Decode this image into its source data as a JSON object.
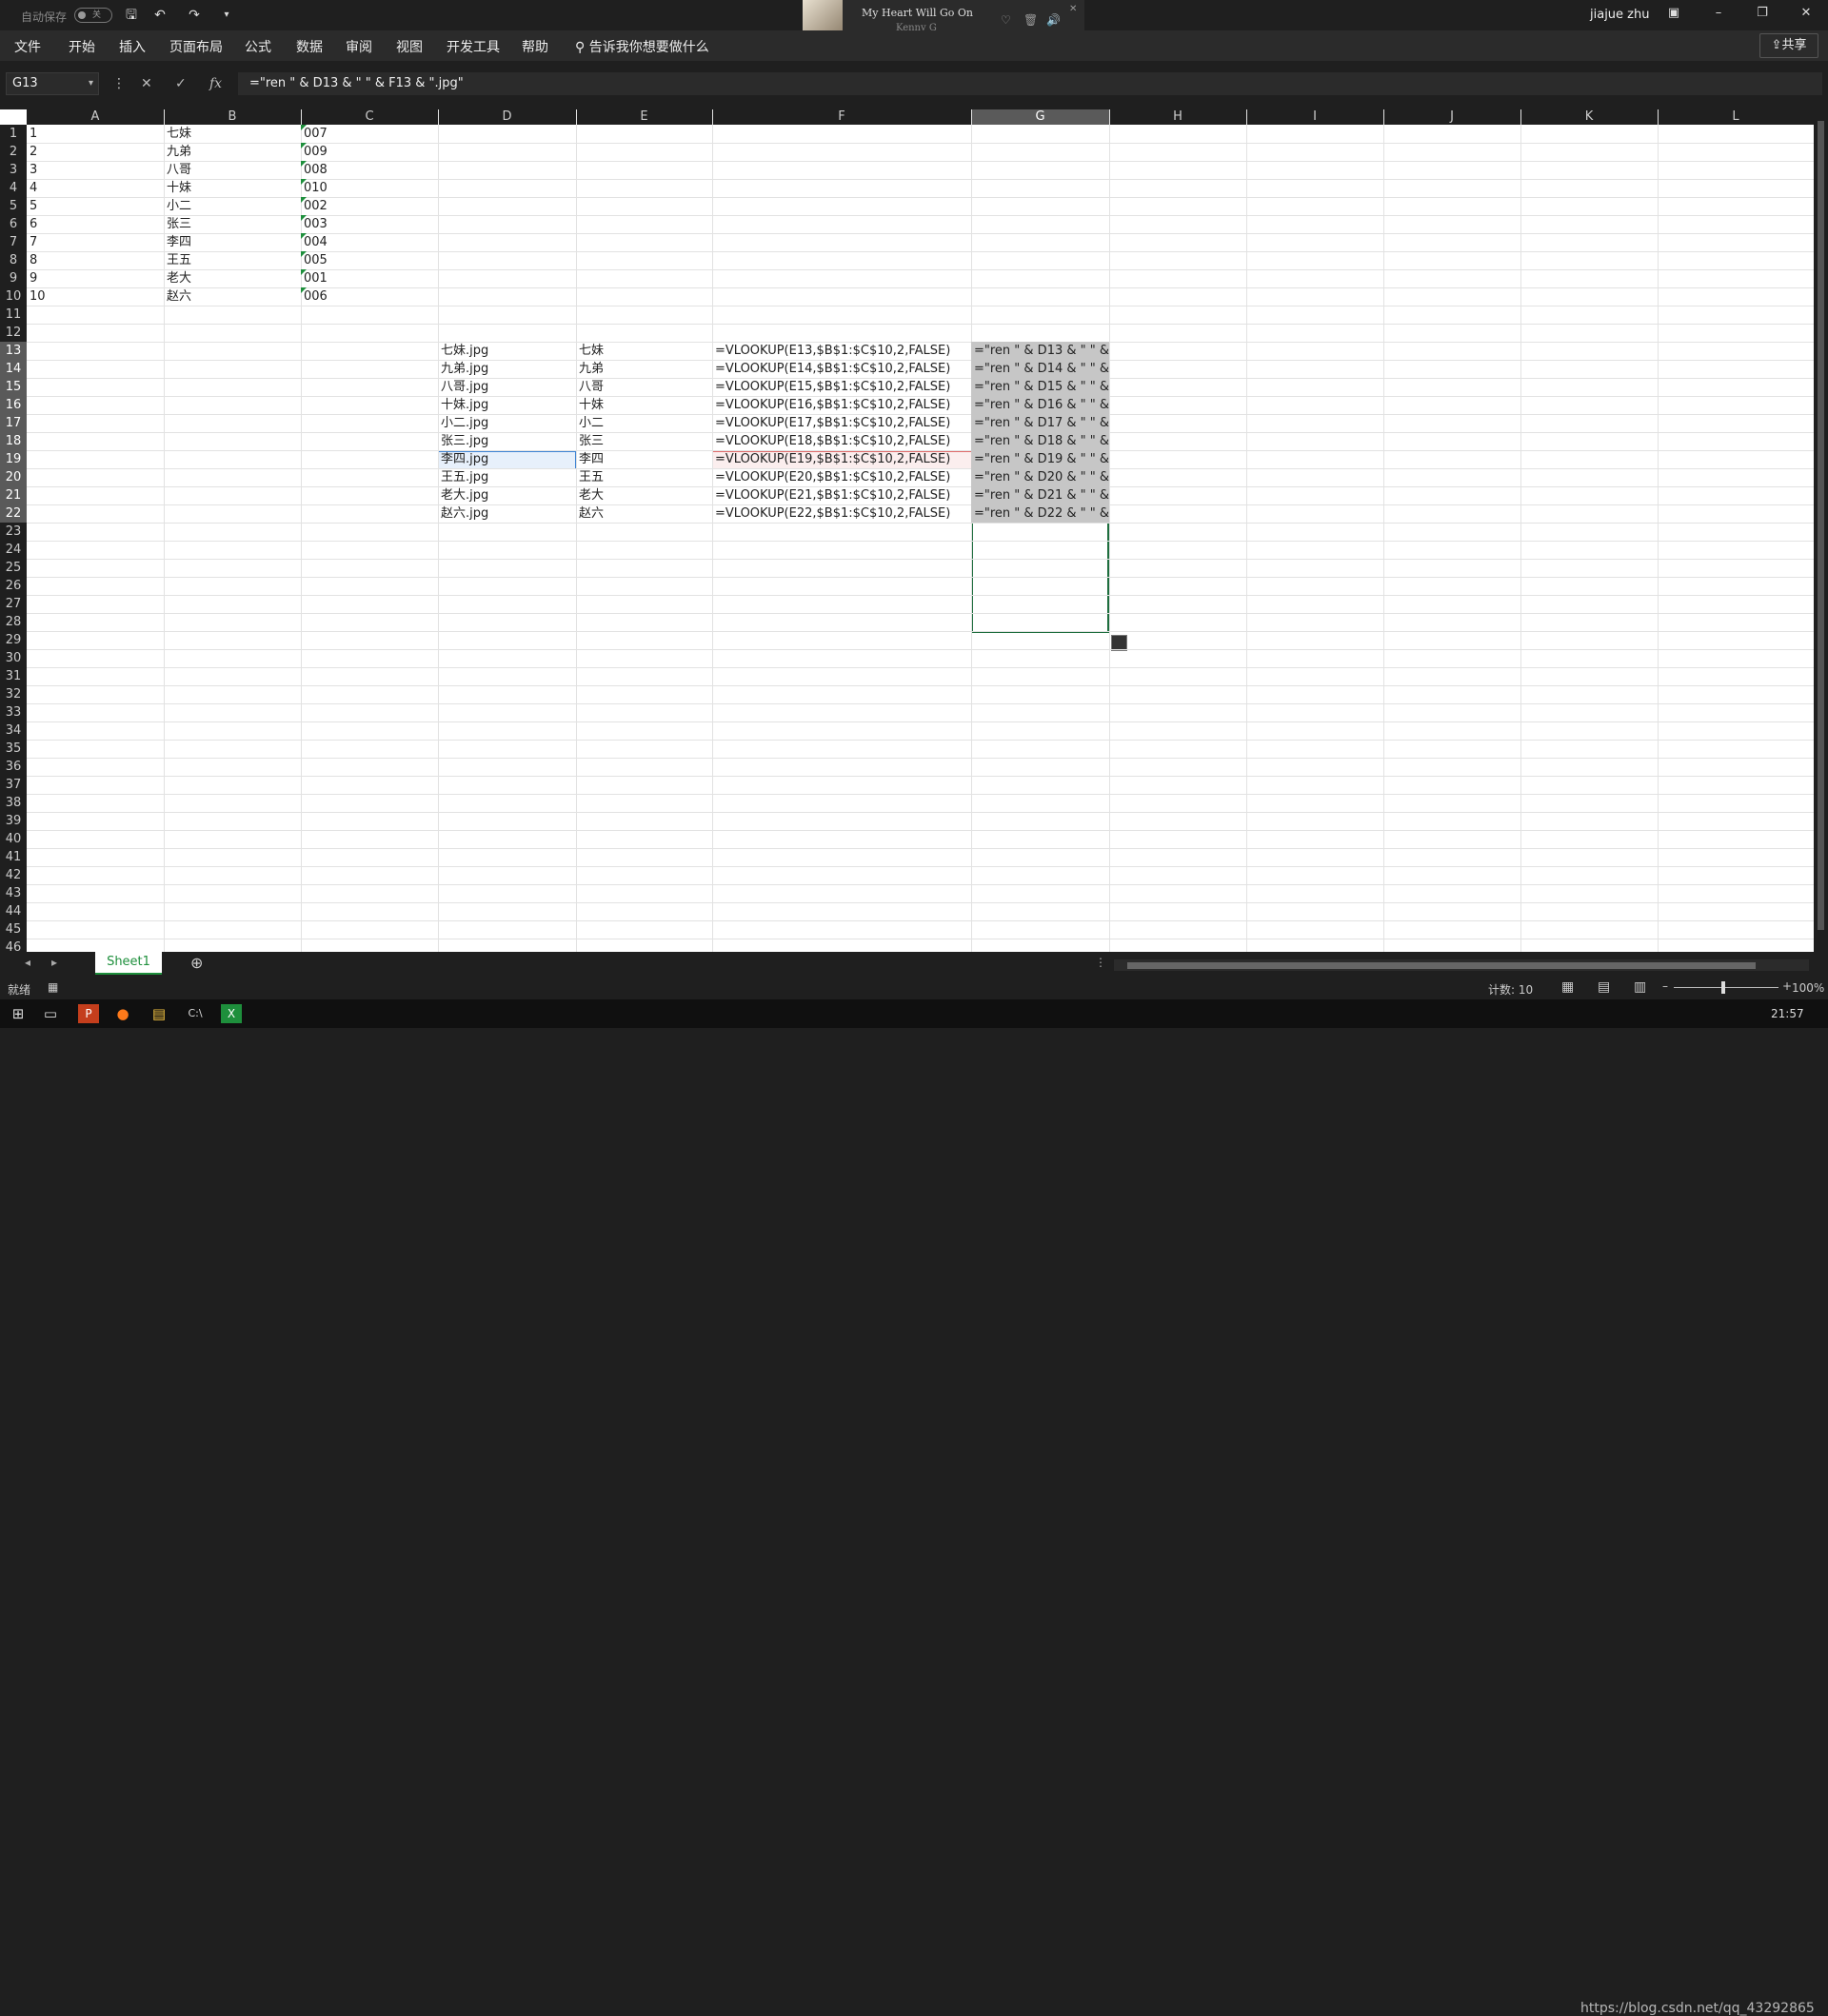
{
  "titlebar": {
    "autosave_label": "自动保存",
    "autosave_state": "关",
    "user": "jiajue zhu"
  },
  "music": {
    "song": "My Heart Will Go On",
    "artist": "Kenny G"
  },
  "ribbon": {
    "tabs": [
      "文件",
      "开始",
      "插入",
      "页面布局",
      "公式",
      "数据",
      "审阅",
      "视图",
      "开发工具",
      "帮助"
    ],
    "search": "告诉我你想要做什么",
    "share": "共享"
  },
  "formula_bar": {
    "namebox": "G13",
    "formula": "=\"ren \" & D13 & \" \" & F13 & \".jpg\""
  },
  "columns": [
    "A",
    "B",
    "C",
    "D",
    "E",
    "F",
    "G",
    "H",
    "I",
    "J",
    "K",
    "L"
  ],
  "rows": [
    "1",
    "2",
    "3",
    "4",
    "5",
    "6",
    "7",
    "8",
    "9",
    "10",
    "11",
    "12",
    "13",
    "14",
    "15",
    "16",
    "17",
    "18",
    "19",
    "20",
    "21",
    "22",
    "23",
    "24",
    "25",
    "26",
    "27",
    "28",
    "29",
    "30",
    "31",
    "32",
    "33",
    "34",
    "35",
    "36",
    "37",
    "38",
    "39",
    "40",
    "41",
    "42",
    "43",
    "44",
    "45",
    "46"
  ],
  "data_a": [
    "1",
    "2",
    "3",
    "4",
    "5",
    "6",
    "7",
    "8",
    "9",
    "10"
  ],
  "data_b": [
    "七妹",
    "九弟",
    "八哥",
    "十妹",
    "小二",
    "张三",
    "李四",
    "王五",
    "老大",
    "赵六"
  ],
  "data_c": [
    "007",
    "009",
    "008",
    "010",
    "002",
    "003",
    "004",
    "005",
    "001",
    "006"
  ],
  "data_d": [
    "七妹.jpg",
    "九弟.jpg",
    "八哥.jpg",
    "十妹.jpg",
    "小二.jpg",
    "张三.jpg",
    "李四.jpg",
    "王五.jpg",
    "老大.jpg",
    "赵六.jpg"
  ],
  "data_e": [
    "七妹",
    "九弟",
    "八哥",
    "十妹",
    "小二",
    "张三",
    "李四",
    "王五",
    "老大",
    "赵六"
  ],
  "data_f": [
    "=VLOOKUP(E13,$B$1:$C$10,2,FALSE)",
    "=VLOOKUP(E14,$B$1:$C$10,2,FALSE)",
    "=VLOOKUP(E15,$B$1:$C$10,2,FALSE)",
    "=VLOOKUP(E16,$B$1:$C$10,2,FALSE)",
    "=VLOOKUP(E17,$B$1:$C$10,2,FALSE)",
    "=VLOOKUP(E18,$B$1:$C$10,2,FALSE)",
    "=VLOOKUP(E19,$B$1:$C$10,2,FALSE)",
    "=VLOOKUP(E20,$B$1:$C$10,2,FALSE)",
    "=VLOOKUP(E21,$B$1:$C$10,2,FALSE)",
    "=VLOOKUP(E22,$B$1:$C$10,2,FALSE)"
  ],
  "data_g": [
    "=\"ren \" & D13 & \" \" &",
    "=\"ren \" & D14 & \" \" &",
    "=\"ren \" & D15 & \" \" &",
    "=\"ren \" & D16 & \" \" &",
    "=\"ren \" & D17 & \" \" &",
    "=\"ren \" & D18 & \" \" &",
    "=\"ren \" & D19 & \" \" &",
    "=\"ren \" & D20 & \" \" &",
    "=\"ren \" & D21 & \" \" &",
    "=\"ren \" & D22 & \" \" &"
  ],
  "sheet": {
    "tab": "Sheet1"
  },
  "status": {
    "ready": "就绪",
    "count": "计数: 10",
    "zoom": "100%"
  },
  "taskbar": {
    "watermark": "https://blog.csdn.net/qq_43292865",
    "time": "21:57"
  },
  "colors": {
    "accent": "#1e8f3c",
    "ref_blue": "#3d83d4",
    "ref_red": "#e06a6a"
  }
}
